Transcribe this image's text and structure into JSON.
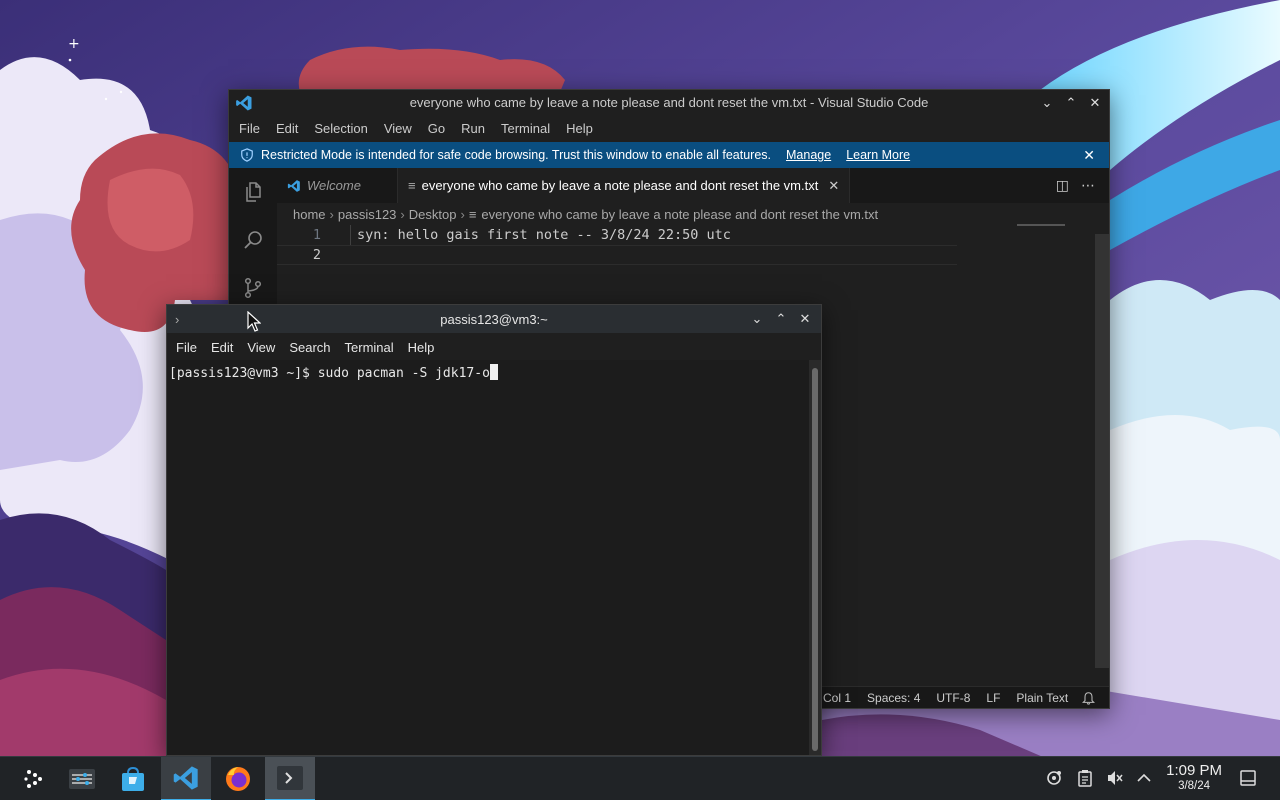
{
  "desktop": {
    "wallpaper": "illustrated-clouds-wallpaper"
  },
  "vscode": {
    "title": "everyone who came by leave a note please and dont reset the vm.txt - Visual Studio Code",
    "menu": [
      "File",
      "Edit",
      "Selection",
      "View",
      "Go",
      "Run",
      "Terminal",
      "Help"
    ],
    "banner": {
      "text": "Restricted Mode is intended for safe code browsing. Trust this window to enable all features.",
      "manage": "Manage",
      "learn_more": "Learn More"
    },
    "tabs": [
      {
        "label": "Welcome"
      },
      {
        "label": "everyone who came by leave a note please and dont reset the vm.txt"
      }
    ],
    "breadcrumb": [
      "home",
      "passis123",
      "Desktop",
      "everyone who came by leave a note please and dont reset the vm.txt"
    ],
    "lines": [
      {
        "num": "1",
        "text": "syn: hello gais first note -- 3/8/24 22:50 utc"
      },
      {
        "num": "2",
        "text": ""
      }
    ],
    "status": {
      "col": "Col 1",
      "spaces": "Spaces: 4",
      "encoding": "UTF-8",
      "eol": "LF",
      "language": "Plain Text"
    },
    "colors": {
      "banner": "#0a4e80",
      "editor_bg": "#1f1f1f",
      "accent": "#3daee9"
    }
  },
  "konsole": {
    "title": "passis123@vm3:~",
    "menu": [
      "File",
      "Edit",
      "View",
      "Search",
      "Terminal",
      "Help"
    ],
    "prompt": "[passis123@vm3 ~]$ sudo pacman -S jdk17-o"
  },
  "taskbar": {
    "apps": [
      "launcher-icon",
      "pager-icon",
      "discover-icon",
      "vscode-icon",
      "firefox-icon",
      "konsole-icon"
    ],
    "clock": {
      "time": "1:09 PM",
      "date": "3/8/24"
    }
  }
}
